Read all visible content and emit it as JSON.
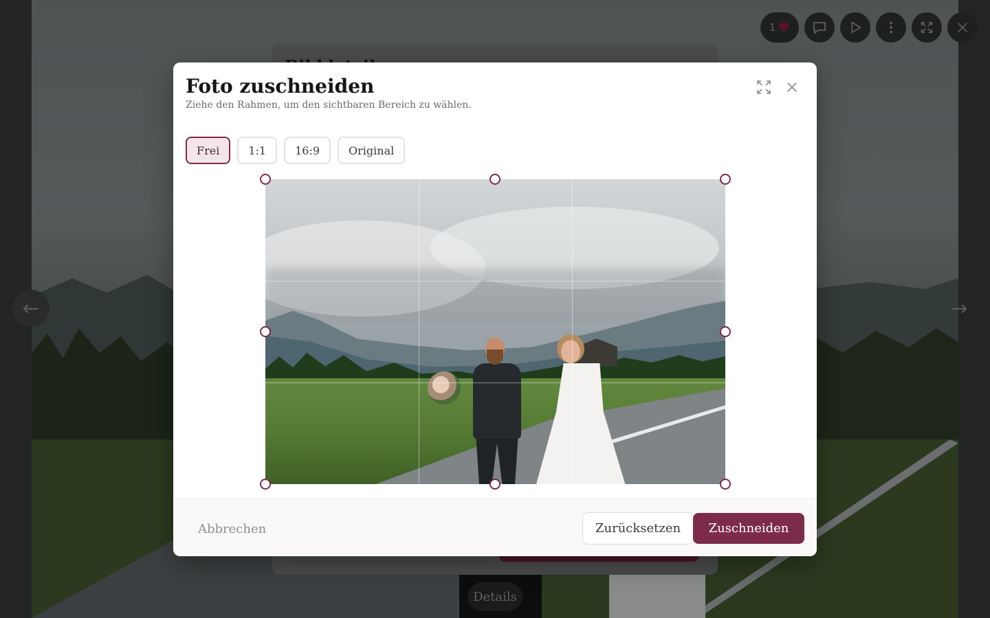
{
  "lightbox": {
    "like_count": "1",
    "details_label": "Details"
  },
  "underlying_dialog": {
    "title": "Bilddetails"
  },
  "crop_modal": {
    "title": "Foto zuschneiden",
    "subtitle": "Ziehe den Rahmen, um den sichtbaren Bereich zu wählen.",
    "aspect_ratios": [
      {
        "label": "Frei",
        "active": true
      },
      {
        "label": "1:1",
        "active": false
      },
      {
        "label": "16:9",
        "active": false
      },
      {
        "label": "Original",
        "active": false
      }
    ],
    "footer": {
      "cancel_label": "Abbrechen",
      "reset_label": "Zurücksetzen",
      "apply_label": "Zuschneiden"
    }
  },
  "colors": {
    "accent": "#7d2b4b",
    "active_chip_bg": "#f3e6ea"
  }
}
